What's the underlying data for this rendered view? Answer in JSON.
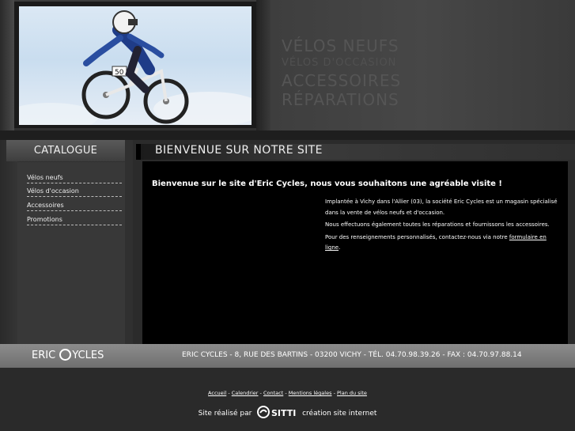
{
  "header": {
    "menu": [
      "VÉLOS NEUFS",
      "VÉLOS D'OCCASION",
      "ACCESSOIRES",
      "RÉPARATIONS"
    ],
    "photo_number": "50"
  },
  "sidebar": {
    "title": "CATALOGUE",
    "items": [
      "Vélos neufs",
      "Vélos d'occasion",
      "Accessoires",
      "Promotions"
    ]
  },
  "main": {
    "title": "BIENVENUE SUR NOTRE SITE",
    "welcome": "Bienvenue sur le site d'Eric Cycles, nous vous souhaitons une agréable visite !",
    "paragraph1": "Implantée à Vichy dans l'Allier (03), la société Eric Cycles est un magasin spécialisé dans la vente de vélos neufs et d'occasion.",
    "paragraph2": "Nous effectuons également toutes les réparations et fournissons les accessoires.",
    "paragraph3_prefix": "Pour des renseignements personnalisés, contactez-nous via notre",
    "form_link": "formulaire en ligne",
    "paragraph3_suffix": "."
  },
  "footer": {
    "logo_part1": "ERIC",
    "logo_part2": "YCLES",
    "address": "ERIC CYCLES - 8, RUE DES BARTINS - 03200 VICHY - TÉL. 04.70.98.39.26 - FAX : 04.70.97.88.14"
  },
  "bottom": {
    "links": [
      "Accueil",
      "Calendrier",
      "Contact",
      "Mentions légales",
      "Plan du site"
    ],
    "separator": " - ",
    "credit_prefix": "Site réalisé par",
    "credit_brand": "SITTI",
    "credit_suffix": "création site internet"
  }
}
